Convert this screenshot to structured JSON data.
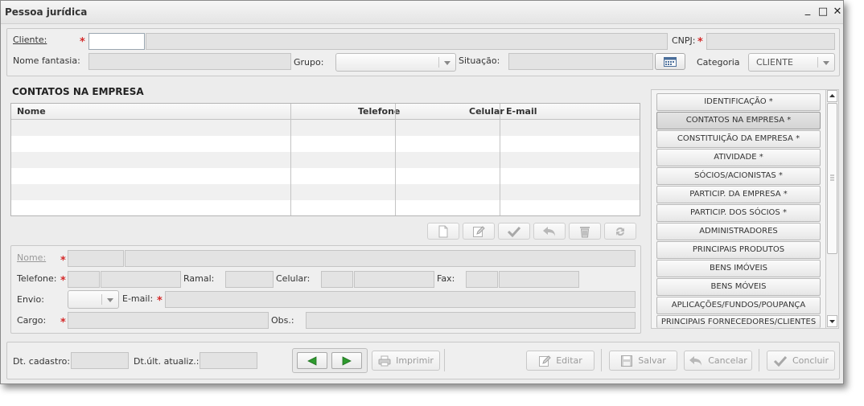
{
  "window": {
    "title": "Pessoa jurídica",
    "minimize": "_",
    "maximize": "□",
    "close": "✕"
  },
  "header": {
    "cliente_label": "Cliente:",
    "cnpj_label": "CNPJ:",
    "nome_fantasia_label": "Nome fantasia:",
    "grupo_label": "Grupo:",
    "grupo_value": "",
    "situacao_label": "Situação:",
    "categoria_label": "Categoria",
    "categoria_value": "CLIENTE"
  },
  "contacts": {
    "section_title": "CONTATOS NA EMPRESA",
    "columns": [
      "Nome",
      "Telefone",
      "Celular",
      "E-mail"
    ],
    "rows": []
  },
  "toolbar": {
    "icons": [
      "new-icon",
      "edit-icon",
      "confirm-icon",
      "undo-icon",
      "trash-icon",
      "refresh-icon"
    ]
  },
  "contact_form": {
    "nome_label": "Nome:",
    "telefone_label": "Telefone:",
    "ramal_label": "Ramal:",
    "celular_label": "Celular:",
    "fax_label": "Fax:",
    "envio_label": "Envio:",
    "email_label": "E-mail:",
    "cargo_label": "Cargo:",
    "obs_label": "Obs.:"
  },
  "nav_sections": [
    "IDENTIFICAÇÃO *",
    "CONTATOS NA EMPRESA *",
    "CONSTITUIÇÃO DA EMPRESA *",
    "ATIVIDADE *",
    "SÓCIOS/ACIONISTAS *",
    "PARTICIP. DA EMPRESA *",
    "PARTICIP. DOS SÓCIOS *",
    "ADMINISTRADORES",
    "PRINCIPAIS PRODUTOS",
    "BENS IMÓVEIS",
    "BENS MÓVEIS",
    "APLICAÇÕES/FUNDOS/POUPANÇA",
    "PRINCIPAIS FORNECEDORES/CLIENTES"
  ],
  "active_nav": "CONTATOS NA EMPRESA *",
  "footer": {
    "dt_cadastro_label": "Dt. cadastro:",
    "dt_ult_label": "Dt.últ. atualiz.:",
    "imprimir": "Imprimir",
    "editar": "Editar",
    "salvar": "Salvar",
    "cancelar": "Cancelar",
    "concluir": "Concluir"
  },
  "colors": {
    "required": "#d42a2a",
    "nav_arrow": "#2e9a2e",
    "disabled_text": "#9a9a9a"
  }
}
